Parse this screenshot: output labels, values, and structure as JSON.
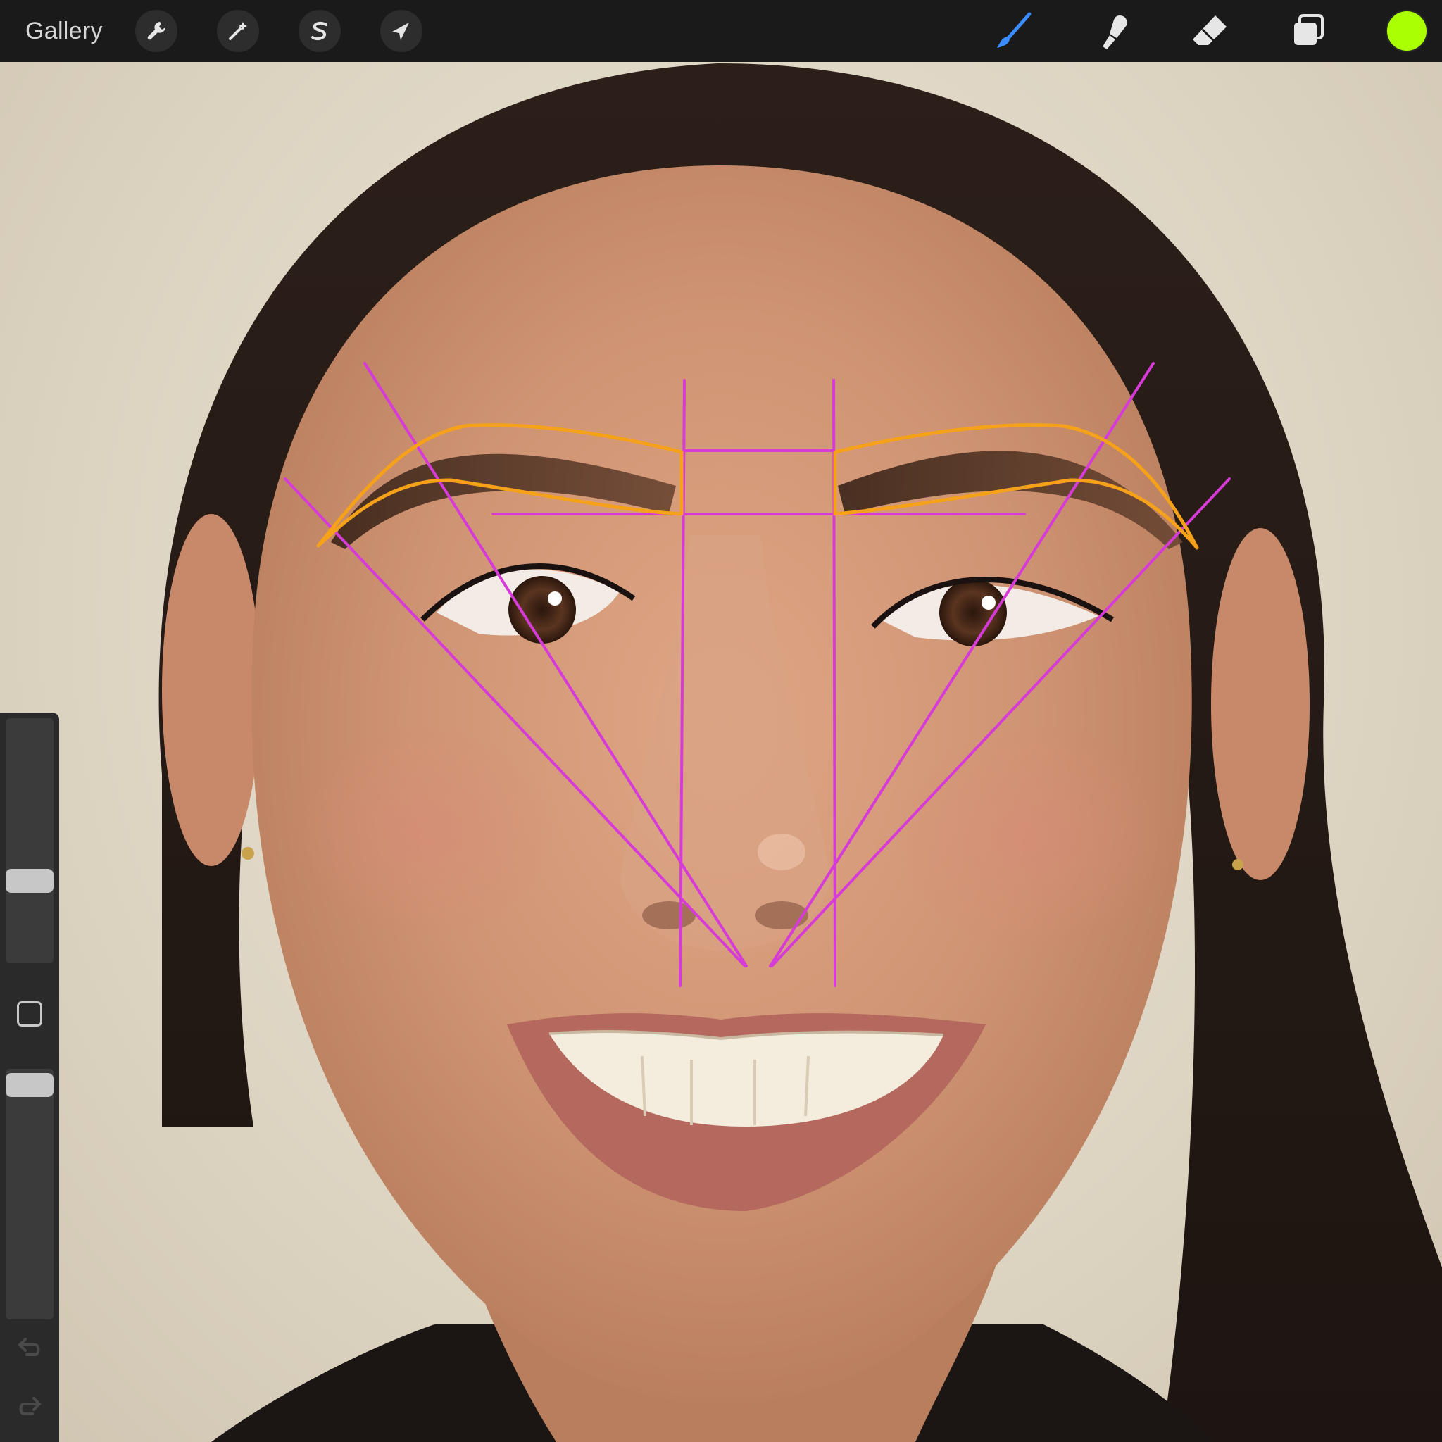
{
  "app": {
    "gallery_label": "Gallery"
  },
  "toolbar_left": [
    {
      "name": "actions",
      "icon": "wrench-icon"
    },
    {
      "name": "adjustments",
      "icon": "magic-wand-icon"
    },
    {
      "name": "selection",
      "icon": "selection-s-icon"
    },
    {
      "name": "transform",
      "icon": "arrow-cursor-icon"
    }
  ],
  "toolbar_right": [
    {
      "name": "paint",
      "icon": "brush-icon",
      "active": true
    },
    {
      "name": "smudge",
      "icon": "smudge-finger-icon",
      "active": false
    },
    {
      "name": "erase",
      "icon": "eraser-icon",
      "active": false
    },
    {
      "name": "layers",
      "icon": "layers-icon",
      "active": false
    }
  ],
  "colors": {
    "current_color": "#aaff00",
    "active_tool": "#3b8cff",
    "guide_lines": "#d63bd8",
    "brow_outline": "#f5a21a"
  },
  "sidebar": {
    "brush_size_level": 0.32,
    "brush_opacity_level": 0.98,
    "modify_icon": "modify-square-icon",
    "undo_icon": "undo-icon",
    "redo_icon": "redo-icon"
  }
}
